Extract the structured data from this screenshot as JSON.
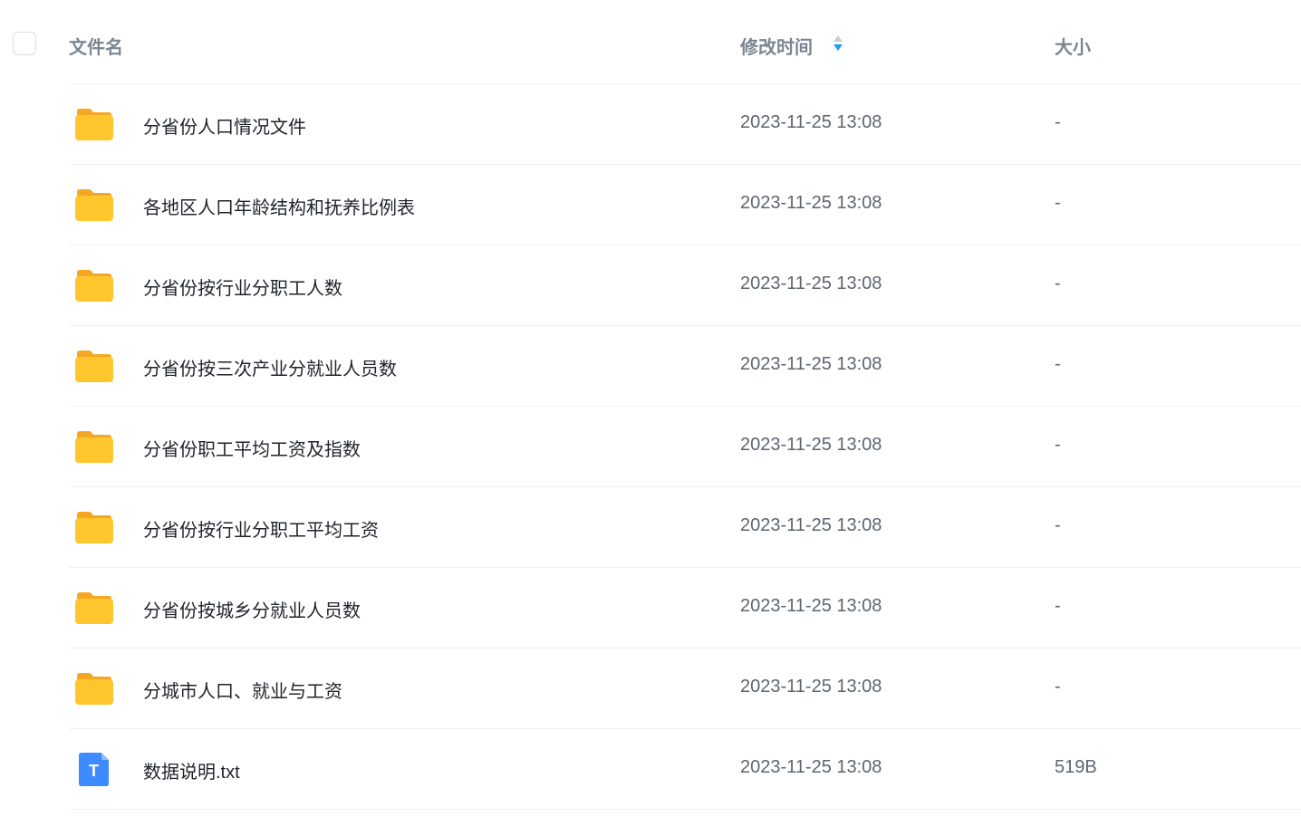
{
  "header": {
    "name_label": "文件名",
    "time_label": "修改时间",
    "size_label": "大小"
  },
  "files": [
    {
      "name": "分省份人口情况文件",
      "time": "2023-11-25 13:08",
      "size": "-",
      "icon": "folder-icon"
    },
    {
      "name": "各地区人口年龄结构和抚养比例表",
      "time": "2023-11-25 13:08",
      "size": "-",
      "icon": "folder-icon"
    },
    {
      "name": "分省份按行业分职工人数",
      "time": "2023-11-25 13:08",
      "size": "-",
      "icon": "folder-icon"
    },
    {
      "name": "分省份按三次产业分就业人员数",
      "time": "2023-11-25 13:08",
      "size": "-",
      "icon": "folder-icon"
    },
    {
      "name": "分省份职工平均工资及指数",
      "time": "2023-11-25 13:08",
      "size": "-",
      "icon": "folder-icon"
    },
    {
      "name": "分省份按行业分职工平均工资",
      "time": "2023-11-25 13:08",
      "size": "-",
      "icon": "folder-icon"
    },
    {
      "name": "分省份按城乡分就业人员数",
      "time": "2023-11-25 13:08",
      "size": "-",
      "icon": "folder-icon"
    },
    {
      "name": "分城市人口、就业与工资",
      "time": "2023-11-25 13:08",
      "size": "-",
      "icon": "folder-icon"
    },
    {
      "name": "数据说明.txt",
      "time": "2023-11-25 13:08",
      "size": "519B",
      "icon": "text-file-icon",
      "icon_letter": "T"
    }
  ],
  "colors": {
    "folder": "#FFC62E",
    "folder_tab": "#F5A623",
    "text_file": "#3D8BFF",
    "sort_active": "#1E9BFF",
    "sort_inactive": "#C9CED6"
  }
}
